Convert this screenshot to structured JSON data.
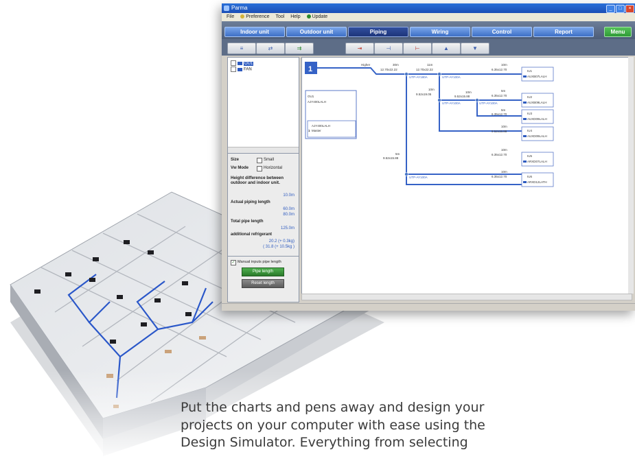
{
  "window": {
    "title": "Parma",
    "controls": [
      "_",
      "□",
      "×"
    ]
  },
  "menubar": {
    "items": [
      {
        "label": "File"
      },
      {
        "label": "Preference",
        "icon": "preference-icon"
      },
      {
        "label": "Tool"
      },
      {
        "label": "Help"
      },
      {
        "label": "Update",
        "icon": "update-icon"
      }
    ]
  },
  "nav": {
    "tabs": [
      "Indoor unit",
      "Outdoor unit",
      "Piping",
      "Wiring",
      "Control",
      "Report"
    ],
    "active": "Piping",
    "menu_label": "Menu"
  },
  "tree": {
    "items": [
      {
        "label": "OU1",
        "selected": true
      },
      {
        "label": "FAN",
        "selected": false
      }
    ]
  },
  "properties": {
    "size_label": "Size",
    "size_option": "Small",
    "view_mode_label": "Vw Mode",
    "view_mode_option": "Horizontal",
    "height_label": "Height difference between outdoor and indoor unit.",
    "height_value": "10.0m",
    "actual_label": "Actual piping length",
    "actual_values": [
      "60.0m",
      "80.0m"
    ],
    "total_label": "Total pipe length",
    "total_value": "125.0m",
    "refrigerant_label": "additional refrigerant",
    "refrigerant_values": [
      "20.2 (+ 0.3kg)",
      "( 31.8 (+ 10.5kg )"
    ]
  },
  "manual": {
    "checkbox_label": "Manual inputs pipe length",
    "pipe_length_button": "Pipe length",
    "reset_button": "Reset length"
  },
  "diagram": {
    "system_number": "1",
    "outdoor_unit": {
      "name": "OU1",
      "model": "AJY400LALH"
    },
    "outdoor_sub": {
      "model": "AJY400LALH",
      "role": "Master",
      "index": "1"
    },
    "pipe_labels": [
      {
        "len": "Higher",
        "size": ""
      },
      {
        "len": "30m",
        "size": "12.70x22.22"
      },
      {
        "len": "11m",
        "size": "12.70x22.22"
      },
      {
        "len": "10m",
        "size": "9.52x19.05"
      },
      {
        "len": "10m",
        "size": "9.52x15.88"
      },
      {
        "len": "5m",
        "size": "9.52x15.88"
      },
      {
        "len": "10m",
        "size": "6.35x12.70"
      }
    ],
    "separators": [
      "UTP-AY180A",
      "UTP-AY100A",
      "UTP-AY100A",
      "UTP-AY100A",
      "UTP-AY100A"
    ],
    "indoor_units": [
      {
        "name": "IU1",
        "model": "AUXB07LALH",
        "len": "10m",
        "size": "6.35x12.70"
      },
      {
        "name": "IU2",
        "model": "AUXB09LALH",
        "len": "5m",
        "size": "6.35x12.70"
      },
      {
        "name": "IU3",
        "model": "AUXD09LALH",
        "len": "5m",
        "size": "6.35x12.70"
      },
      {
        "name": "IU4",
        "model": "AUXD09LALH",
        "len": "10m",
        "size": "9.52x15.88"
      },
      {
        "name": "IU5",
        "model": "ARXD07LALH",
        "len": "10m",
        "size": "6.35x12.70"
      },
      {
        "name": "IU6",
        "model": "ARXD12LATH",
        "len": "10m",
        "size": "6.35x12.70"
      }
    ]
  },
  "caption": {
    "lines": [
      "Put the charts and pens away and design your",
      "projects on your computer with ease using the",
      "Design Simulator. Everything from selecting"
    ]
  }
}
